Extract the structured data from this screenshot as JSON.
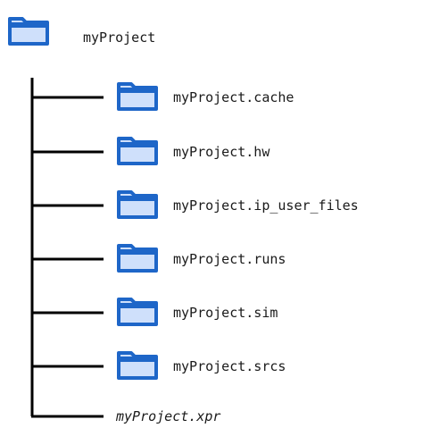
{
  "root": {
    "label": "myProject",
    "icon": "folder-icon"
  },
  "children": [
    {
      "label": "myProject.cache",
      "icon": "folder-icon",
      "type": "folder"
    },
    {
      "label": "myProject.hw",
      "icon": "folder-icon",
      "type": "folder"
    },
    {
      "label": "myProject.ip_user_files",
      "icon": "folder-icon",
      "type": "folder"
    },
    {
      "label": "myProject.runs",
      "icon": "folder-icon",
      "type": "folder"
    },
    {
      "label": "myProject.sim",
      "icon": "folder-icon",
      "type": "folder"
    },
    {
      "label": "myProject.srcs",
      "icon": "folder-icon",
      "type": "folder"
    }
  ],
  "file": {
    "label": "myProject.xpr",
    "type": "file"
  },
  "colors": {
    "folder_stroke": "#1e66c8",
    "folder_fill": "#cfe0fb",
    "folder_tab": "#1e66c8",
    "line": "#000000"
  }
}
